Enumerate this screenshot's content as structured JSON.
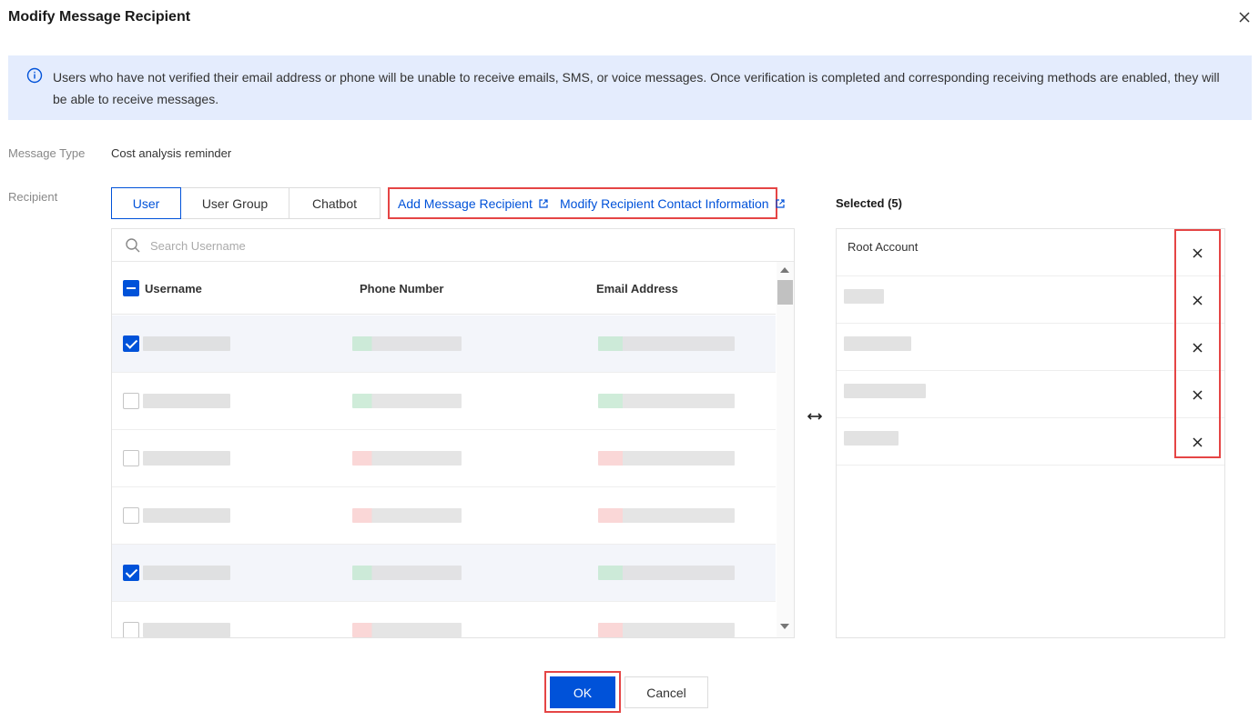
{
  "dialog": {
    "title": "Modify Message Recipient"
  },
  "notice": {
    "text": "Users who have not verified their email address or phone will be unable to receive emails, SMS, or voice messages. Once verification is completed and corresponding receiving methods are enabled, they will be able to receive messages."
  },
  "message_type": {
    "label": "Message Type",
    "value": "Cost analysis reminder"
  },
  "recipient": {
    "label": "Recipient",
    "tabs": [
      "User",
      "User Group",
      "Chatbot"
    ],
    "active_tab": "User",
    "links": {
      "add": "Add Message Recipient",
      "modify": "Modify Recipient Contact Information"
    }
  },
  "search": {
    "placeholder": "Search Username"
  },
  "table": {
    "columns": [
      "Username",
      "Phone Number",
      "Email Address"
    ],
    "rows": [
      {
        "checked": true,
        "contact": "verified"
      },
      {
        "checked": false,
        "contact": "verified"
      },
      {
        "checked": false,
        "contact": "unverified"
      },
      {
        "checked": false,
        "contact": "unverified"
      },
      {
        "checked": true,
        "contact": "verified"
      },
      {
        "checked": false,
        "contact": "unverified"
      }
    ]
  },
  "selected": {
    "title": "Selected (5)",
    "items": [
      "Root Account",
      "",
      "",
      "",
      ""
    ]
  },
  "footer": {
    "ok": "OK",
    "cancel": "Cancel"
  },
  "icons": {
    "close": "close-icon",
    "info": "info-icon",
    "external": "external-link-icon",
    "search": "search-icon",
    "swap": "swap-horizontal-icon",
    "remove": "close-icon"
  },
  "colors": {
    "primary": "#0052d9",
    "highlight_border": "#e54545",
    "notice_bg": "#e4ecfd"
  }
}
